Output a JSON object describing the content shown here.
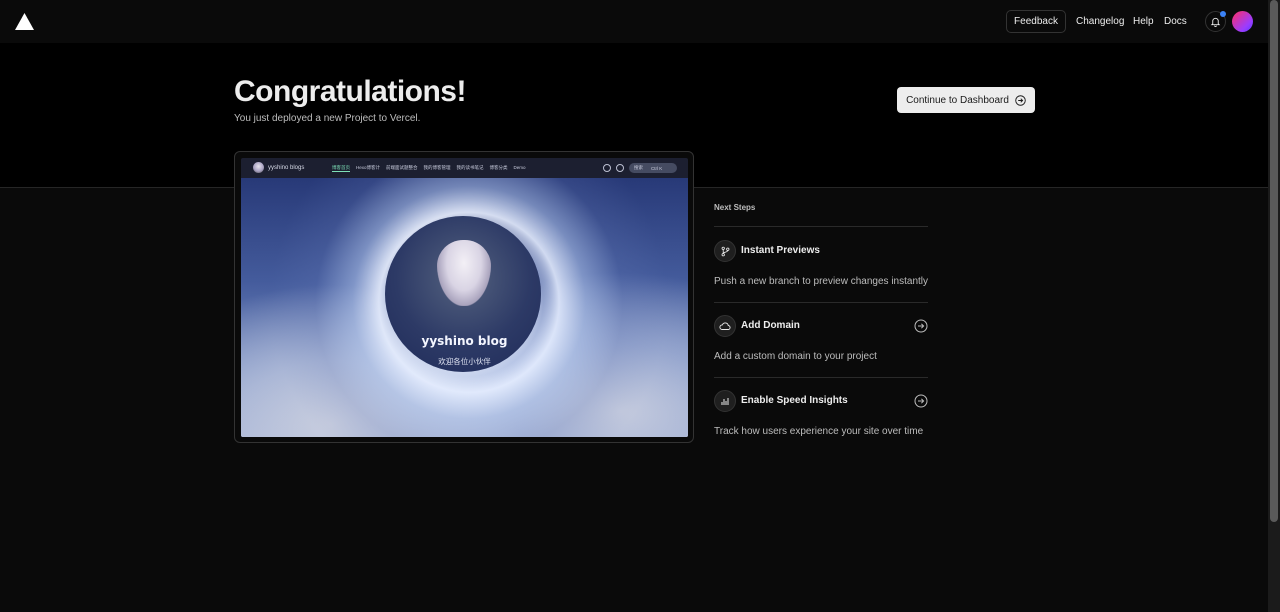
{
  "nav": {
    "feedback": "Feedback",
    "links": [
      "Changelog",
      "Help",
      "Docs"
    ],
    "notification_dot_color": "#3b82f6"
  },
  "hero": {
    "title": "Congratulations!",
    "subtitle": "You just deployed a new Project to Vercel.",
    "continue_label": "Continue to Dashboard"
  },
  "preview": {
    "site_name": "yyshino blogs",
    "menu": [
      "博客首页",
      "Hexo博客计",
      "前端面试题整合",
      "我的博客管理",
      "我的读书笔记",
      "博客分类",
      "Demo"
    ],
    "search": "搜索",
    "search_shortcut": "Ctrl K",
    "hero_title": "yyshino blog",
    "hero_subtitle": "欢迎各位小伙伴"
  },
  "next_steps": {
    "label": "Next Steps",
    "items": [
      {
        "title": "Instant Previews",
        "description": "Push a new branch to preview changes instantly",
        "icon": "git-branch-icon",
        "has_arrow": false
      },
      {
        "title": "Add Domain",
        "description": "Add a custom domain to your project",
        "icon": "cloud-icon",
        "has_arrow": true
      },
      {
        "title": "Enable Speed Insights",
        "description": "Track how users experience your site over time",
        "icon": "bar-chart-icon",
        "has_arrow": true
      }
    ]
  }
}
